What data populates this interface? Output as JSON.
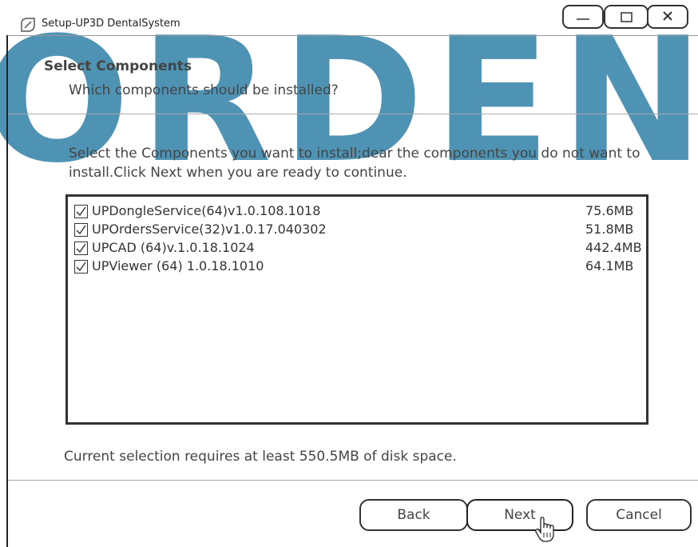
{
  "window": {
    "title": "Setup-UP3D DentalSystem",
    "watermark": "ORDEN",
    "controls": [
      "minimize",
      "maximize",
      "close"
    ]
  },
  "header": {
    "title": "Select Components",
    "subtitle": "Which components should be installed?"
  },
  "instructions": "Select  the Components you want to install;dear the components you do not want to install.Click Next when you are ready to continue.",
  "components": [
    {
      "name": "UPDongleService(64)v1.0.108.1018",
      "size": "75.6MB",
      "checked": true
    },
    {
      "name": "UPOrdersService(32)v1.0.17.040302",
      "size": "51.8MB",
      "checked": true
    },
    {
      "name": "UPCAD (64)v.1.0.18.1024",
      "size": "442.4MB",
      "checked": true
    },
    {
      "name": "UPViewer (64) 1.0.18.1010",
      "size": "64.1MB",
      "checked": true
    }
  ],
  "space_required": "Current selection requires at least 550.5MB of disk space.",
  "buttons": {
    "back": "Back",
    "next": "Next",
    "cancel": "Cancel"
  },
  "colors": {
    "watermark": "#4f93b4",
    "border": "#333333",
    "text": "#444444"
  }
}
